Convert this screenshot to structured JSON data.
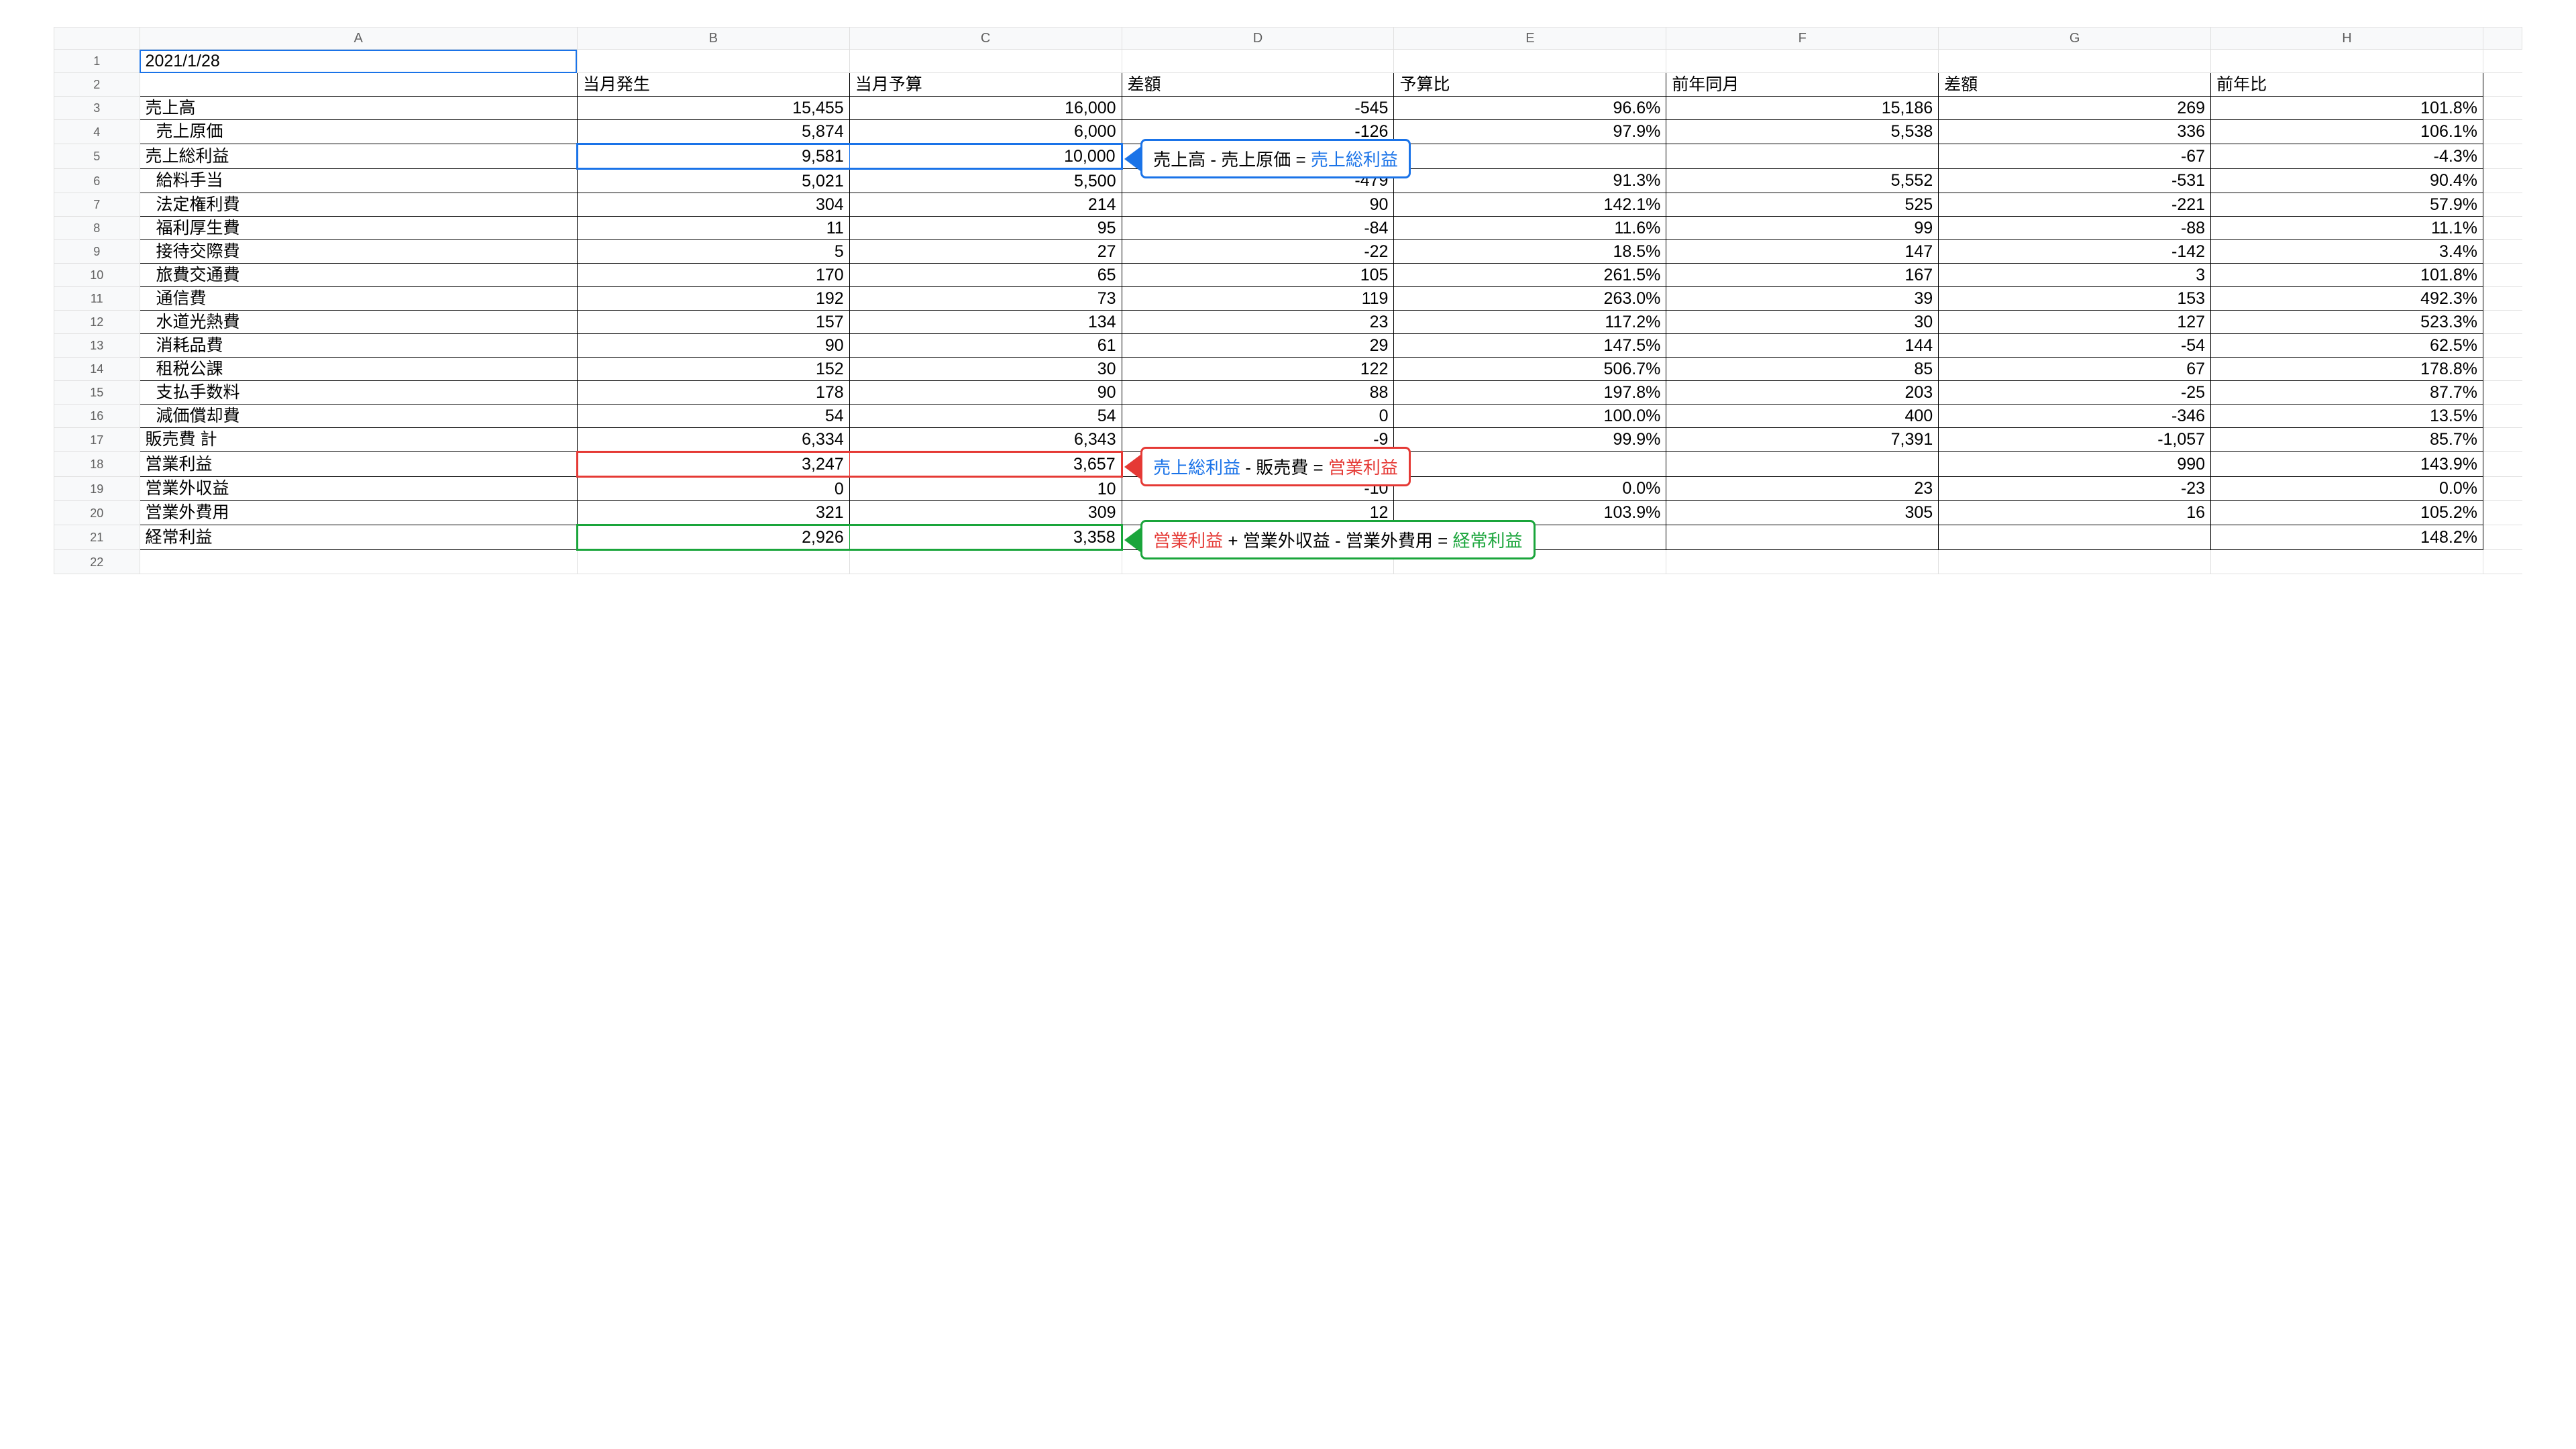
{
  "sheet": {
    "date_cell": "2021/1/28",
    "column_letters": [
      "A",
      "B",
      "C",
      "D",
      "E",
      "F",
      "G",
      "H"
    ],
    "headers": {
      "A": "",
      "B": "当月発生",
      "C": "当月予算",
      "D": "差額",
      "E": "予算比",
      "F": "前年同月",
      "G": "差額",
      "H": "前年比"
    },
    "rows": [
      {
        "num": 3,
        "label": "売上高",
        "indent": false,
        "B": "15,455",
        "C": "16,000",
        "D": "-545",
        "E": "96.6%",
        "F": "15,186",
        "G": "269",
        "H": "101.8%"
      },
      {
        "num": 4,
        "label": "売上原価",
        "indent": true,
        "B": "5,874",
        "C": "6,000",
        "D": "-126",
        "E": "97.9%",
        "F": "5,538",
        "G": "336",
        "H": "106.1%"
      },
      {
        "num": 5,
        "label": "売上総利益",
        "indent": false,
        "hl": "blue",
        "B": "9,581",
        "C": "10,000",
        "D": "",
        "E": "",
        "F": "",
        "G": "-67",
        "H": "-4.3%"
      },
      {
        "num": 6,
        "label": "給料手当",
        "indent": true,
        "B": "5,021",
        "C": "5,500",
        "D": "-479",
        "E": "91.3%",
        "F": "5,552",
        "G": "-531",
        "H": "90.4%"
      },
      {
        "num": 7,
        "label": "法定権利費",
        "indent": true,
        "B": "304",
        "C": "214",
        "D": "90",
        "E": "142.1%",
        "F": "525",
        "G": "-221",
        "H": "57.9%"
      },
      {
        "num": 8,
        "label": "福利厚生費",
        "indent": true,
        "B": "11",
        "C": "95",
        "D": "-84",
        "E": "11.6%",
        "F": "99",
        "G": "-88",
        "H": "11.1%"
      },
      {
        "num": 9,
        "label": "接待交際費",
        "indent": true,
        "B": "5",
        "C": "27",
        "D": "-22",
        "E": "18.5%",
        "F": "147",
        "G": "-142",
        "H": "3.4%"
      },
      {
        "num": 10,
        "label": "旅費交通費",
        "indent": true,
        "B": "170",
        "C": "65",
        "D": "105",
        "E": "261.5%",
        "F": "167",
        "G": "3",
        "H": "101.8%"
      },
      {
        "num": 11,
        "label": "通信費",
        "indent": true,
        "B": "192",
        "C": "73",
        "D": "119",
        "E": "263.0%",
        "F": "39",
        "G": "153",
        "H": "492.3%"
      },
      {
        "num": 12,
        "label": "水道光熱費",
        "indent": true,
        "B": "157",
        "C": "134",
        "D": "23",
        "E": "117.2%",
        "F": "30",
        "G": "127",
        "H": "523.3%"
      },
      {
        "num": 13,
        "label": "消耗品費",
        "indent": true,
        "B": "90",
        "C": "61",
        "D": "29",
        "E": "147.5%",
        "F": "144",
        "G": "-54",
        "H": "62.5%"
      },
      {
        "num": 14,
        "label": "租税公課",
        "indent": true,
        "B": "152",
        "C": "30",
        "D": "122",
        "E": "506.7%",
        "F": "85",
        "G": "67",
        "H": "178.8%"
      },
      {
        "num": 15,
        "label": "支払手数料",
        "indent": true,
        "B": "178",
        "C": "90",
        "D": "88",
        "E": "197.8%",
        "F": "203",
        "G": "-25",
        "H": "87.7%"
      },
      {
        "num": 16,
        "label": "減価償却費",
        "indent": true,
        "B": "54",
        "C": "54",
        "D": "0",
        "E": "100.0%",
        "F": "400",
        "G": "-346",
        "H": "13.5%"
      },
      {
        "num": 17,
        "label": "販売費 計",
        "indent": false,
        "B": "6,334",
        "C": "6,343",
        "D": "-9",
        "E": "99.9%",
        "F": "7,391",
        "G": "-1,057",
        "H": "85.7%"
      },
      {
        "num": 18,
        "label": "営業利益",
        "indent": false,
        "hl": "red",
        "B": "3,247",
        "C": "3,657",
        "D": "",
        "E": "",
        "F": "",
        "G": "990",
        "H": "143.9%"
      },
      {
        "num": 19,
        "label": "営業外収益",
        "indent": false,
        "B": "0",
        "C": "10",
        "D": "-10",
        "E": "0.0%",
        "F": "23",
        "G": "-23",
        "H": "0.0%"
      },
      {
        "num": 20,
        "label": "営業外費用",
        "indent": false,
        "B": "321",
        "C": "309",
        "D": "12",
        "E": "103.9%",
        "F": "305",
        "G": "16",
        "H": "105.2%"
      },
      {
        "num": 21,
        "label": "経常利益",
        "indent": false,
        "hl": "green",
        "B": "2,926",
        "C": "3,358",
        "D": "",
        "E": "",
        "F": "",
        "G": "",
        "H": "148.2%"
      }
    ]
  },
  "callouts": {
    "blue": {
      "parts": [
        {
          "t": "売上高",
          "c": "black"
        },
        {
          "t": " - ",
          "c": "black"
        },
        {
          "t": "売上原価",
          "c": "black"
        },
        {
          "t": " = ",
          "c": "black"
        },
        {
          "t": "売上総利益",
          "c": "blue"
        }
      ]
    },
    "red": {
      "parts": [
        {
          "t": "売上総利益",
          "c": "blue"
        },
        {
          "t": " - ",
          "c": "black"
        },
        {
          "t": "販売費",
          "c": "black"
        },
        {
          "t": " = ",
          "c": "black"
        },
        {
          "t": "営業利益",
          "c": "red"
        }
      ]
    },
    "green": {
      "parts": [
        {
          "t": "営業利益",
          "c": "red"
        },
        {
          "t": " + ",
          "c": "black"
        },
        {
          "t": "営業外収益",
          "c": "black"
        },
        {
          "t": " - ",
          "c": "black"
        },
        {
          "t": "営業外費用",
          "c": "black"
        },
        {
          "t": " = ",
          "c": "black"
        },
        {
          "t": "経常利益",
          "c": "green"
        }
      ]
    }
  }
}
